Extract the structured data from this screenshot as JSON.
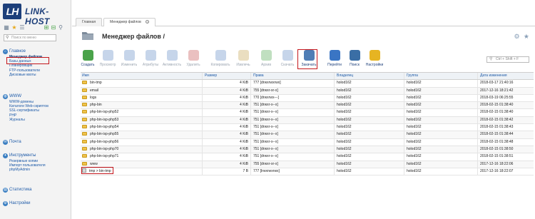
{
  "logo": {
    "mark": "LH",
    "text": "LINK-HOST"
  },
  "sidebar": {
    "search_placeholder": "Поиск по меню",
    "sections": [
      {
        "title": "Главное",
        "items": [
          "Менеджер файлов",
          "Базы данных",
          "Планировщик",
          "FTP-пользователи",
          "Дисковые квоты"
        ]
      },
      {
        "title": "WWW",
        "items": [
          "WWW-домены",
          "Каталоги Web-скриптов",
          "SSL-сертификаты",
          "PHP",
          "Журналы"
        ]
      },
      {
        "title": "Почта",
        "items": []
      },
      {
        "title": "Инструменты",
        "items": [
          "Резервные копии",
          "Импорт пользователя",
          "phpMyAdmin"
        ]
      },
      {
        "title": "Статистика",
        "items": []
      },
      {
        "title": "Настройки",
        "items": []
      }
    ]
  },
  "tabs": [
    "Главная",
    "Менеджер файлов"
  ],
  "page": {
    "title": "Менеджер файлов /"
  },
  "toolbar": {
    "buttons": [
      {
        "label": "Создать",
        "icon": "create-icon",
        "enabled": true,
        "color": "#4aa34a"
      },
      {
        "label": "Просмотр",
        "icon": "view-icon",
        "enabled": false,
        "color": "#5b86c4"
      },
      {
        "label": "Изменить",
        "icon": "edit-icon",
        "enabled": false,
        "color": "#5b86c4"
      },
      {
        "label": "Атрибуты",
        "icon": "attributes-icon",
        "enabled": false,
        "color": "#5b86c4"
      },
      {
        "label": "Активность",
        "icon": "activity-icon",
        "enabled": false,
        "color": "#5b86c4"
      },
      {
        "label": "Удалить",
        "icon": "delete-icon",
        "enabled": false,
        "color": "#c44b4b"
      },
      {
        "label": "Копировать",
        "icon": "copy-icon",
        "enabled": false,
        "color": "#5b86c4"
      },
      {
        "label": "Извлечь",
        "icon": "extract-icon",
        "enabled": false,
        "color": "#c4a14b"
      },
      {
        "label": "Архив",
        "icon": "archive-icon",
        "enabled": false,
        "color": "#4aa34a"
      },
      {
        "label": "Скачать",
        "icon": "download-icon",
        "enabled": false,
        "color": "#5b86c4"
      },
      {
        "label": "Закачать",
        "icon": "upload-icon",
        "enabled": true,
        "color": "#4f7db5"
      },
      {
        "label": "Перейти",
        "icon": "goto-icon",
        "enabled": true,
        "color": "#3a75c4"
      },
      {
        "label": "Поиск",
        "icon": "search-icon",
        "enabled": true,
        "color": "#3a6ea5"
      },
      {
        "label": "Настройки",
        "icon": "settings-icon",
        "enabled": true,
        "color": "#e6b422"
      }
    ],
    "filter_placeholder": "Ctrl + Shift + F"
  },
  "table": {
    "columns": [
      "Имя",
      "Размер",
      "Права",
      "Владелец",
      "Группа",
      "Дата изменения"
    ],
    "rows": [
      {
        "name": "bin-tmp",
        "size": "4 KiB",
        "perms": "777 [drwxrwxrwx]",
        "owner": "holod162",
        "group": "holod162",
        "date": "2018-03-17 21:40:16",
        "type": "folder"
      },
      {
        "name": "email",
        "size": "4 KiB",
        "perms": "755 [drwxr-xr-x]",
        "owner": "holod162",
        "group": "holod162",
        "date": "2017-12-16 18:21:42",
        "type": "folder"
      },
      {
        "name": "logs",
        "size": "4 KiB",
        "perms": "770 [drwxrwx---]",
        "owner": "holod162",
        "group": "holod162",
        "date": "2018-03-19 06:25:55",
        "type": "folder"
      },
      {
        "name": "php-bin",
        "size": "4 KiB",
        "perms": "751 [drwxr-x--x]",
        "owner": "holod162",
        "group": "holod162",
        "date": "2018-02-15 01:38:40",
        "type": "folder"
      },
      {
        "name": "php-bin-isp-php52",
        "size": "4 KiB",
        "perms": "751 [drwxr-x--x]",
        "owner": "holod162",
        "group": "holod162",
        "date": "2018-02-15 01:38:40",
        "type": "folder"
      },
      {
        "name": "php-bin-isp-php53",
        "size": "4 KiB",
        "perms": "751 [drwxr-x--x]",
        "owner": "holod162",
        "group": "holod162",
        "date": "2018-02-15 01:38:42",
        "type": "folder"
      },
      {
        "name": "php-bin-isp-php54",
        "size": "4 KiB",
        "perms": "751 [drwxr-x--x]",
        "owner": "holod162",
        "group": "holod162",
        "date": "2018-02-15 01:38:43",
        "type": "folder"
      },
      {
        "name": "php-bin-isp-php55",
        "size": "4 KiB",
        "perms": "751 [drwxr-x--x]",
        "owner": "holod162",
        "group": "holod162",
        "date": "2018-02-15 01:38:44",
        "type": "folder"
      },
      {
        "name": "php-bin-isp-php56",
        "size": "4 KiB",
        "perms": "751 [drwxr-x--x]",
        "owner": "holod162",
        "group": "holod162",
        "date": "2018-02-15 01:38:48",
        "type": "folder"
      },
      {
        "name": "php-bin-isp-php70",
        "size": "4 KiB",
        "perms": "751 [drwxr-x--x]",
        "owner": "holod162",
        "group": "holod162",
        "date": "2018-02-15 01:38:50",
        "type": "folder"
      },
      {
        "name": "php-bin-isp-php71",
        "size": "4 KiB",
        "perms": "751 [drwxr-x--x]",
        "owner": "holod162",
        "group": "holod162",
        "date": "2018-02-15 01:38:51",
        "type": "folder"
      },
      {
        "name": "www",
        "size": "4 KiB",
        "perms": "755 [drwxr-xr-x]",
        "owner": "holod162",
        "group": "holod162",
        "date": "2017-12-16 18:22:06",
        "type": "folder"
      },
      {
        "name": "tmp > bin-tmp",
        "size": "7 B",
        "perms": "777 [lrwxrwxrwx]",
        "owner": "holod162",
        "group": "holod162",
        "date": "2017-12-16 18:22:07",
        "type": "link"
      }
    ]
  },
  "colors": {
    "brand": "#1d3f7a",
    "accent": "#1d5aa8",
    "highlight": "#c4161c"
  }
}
